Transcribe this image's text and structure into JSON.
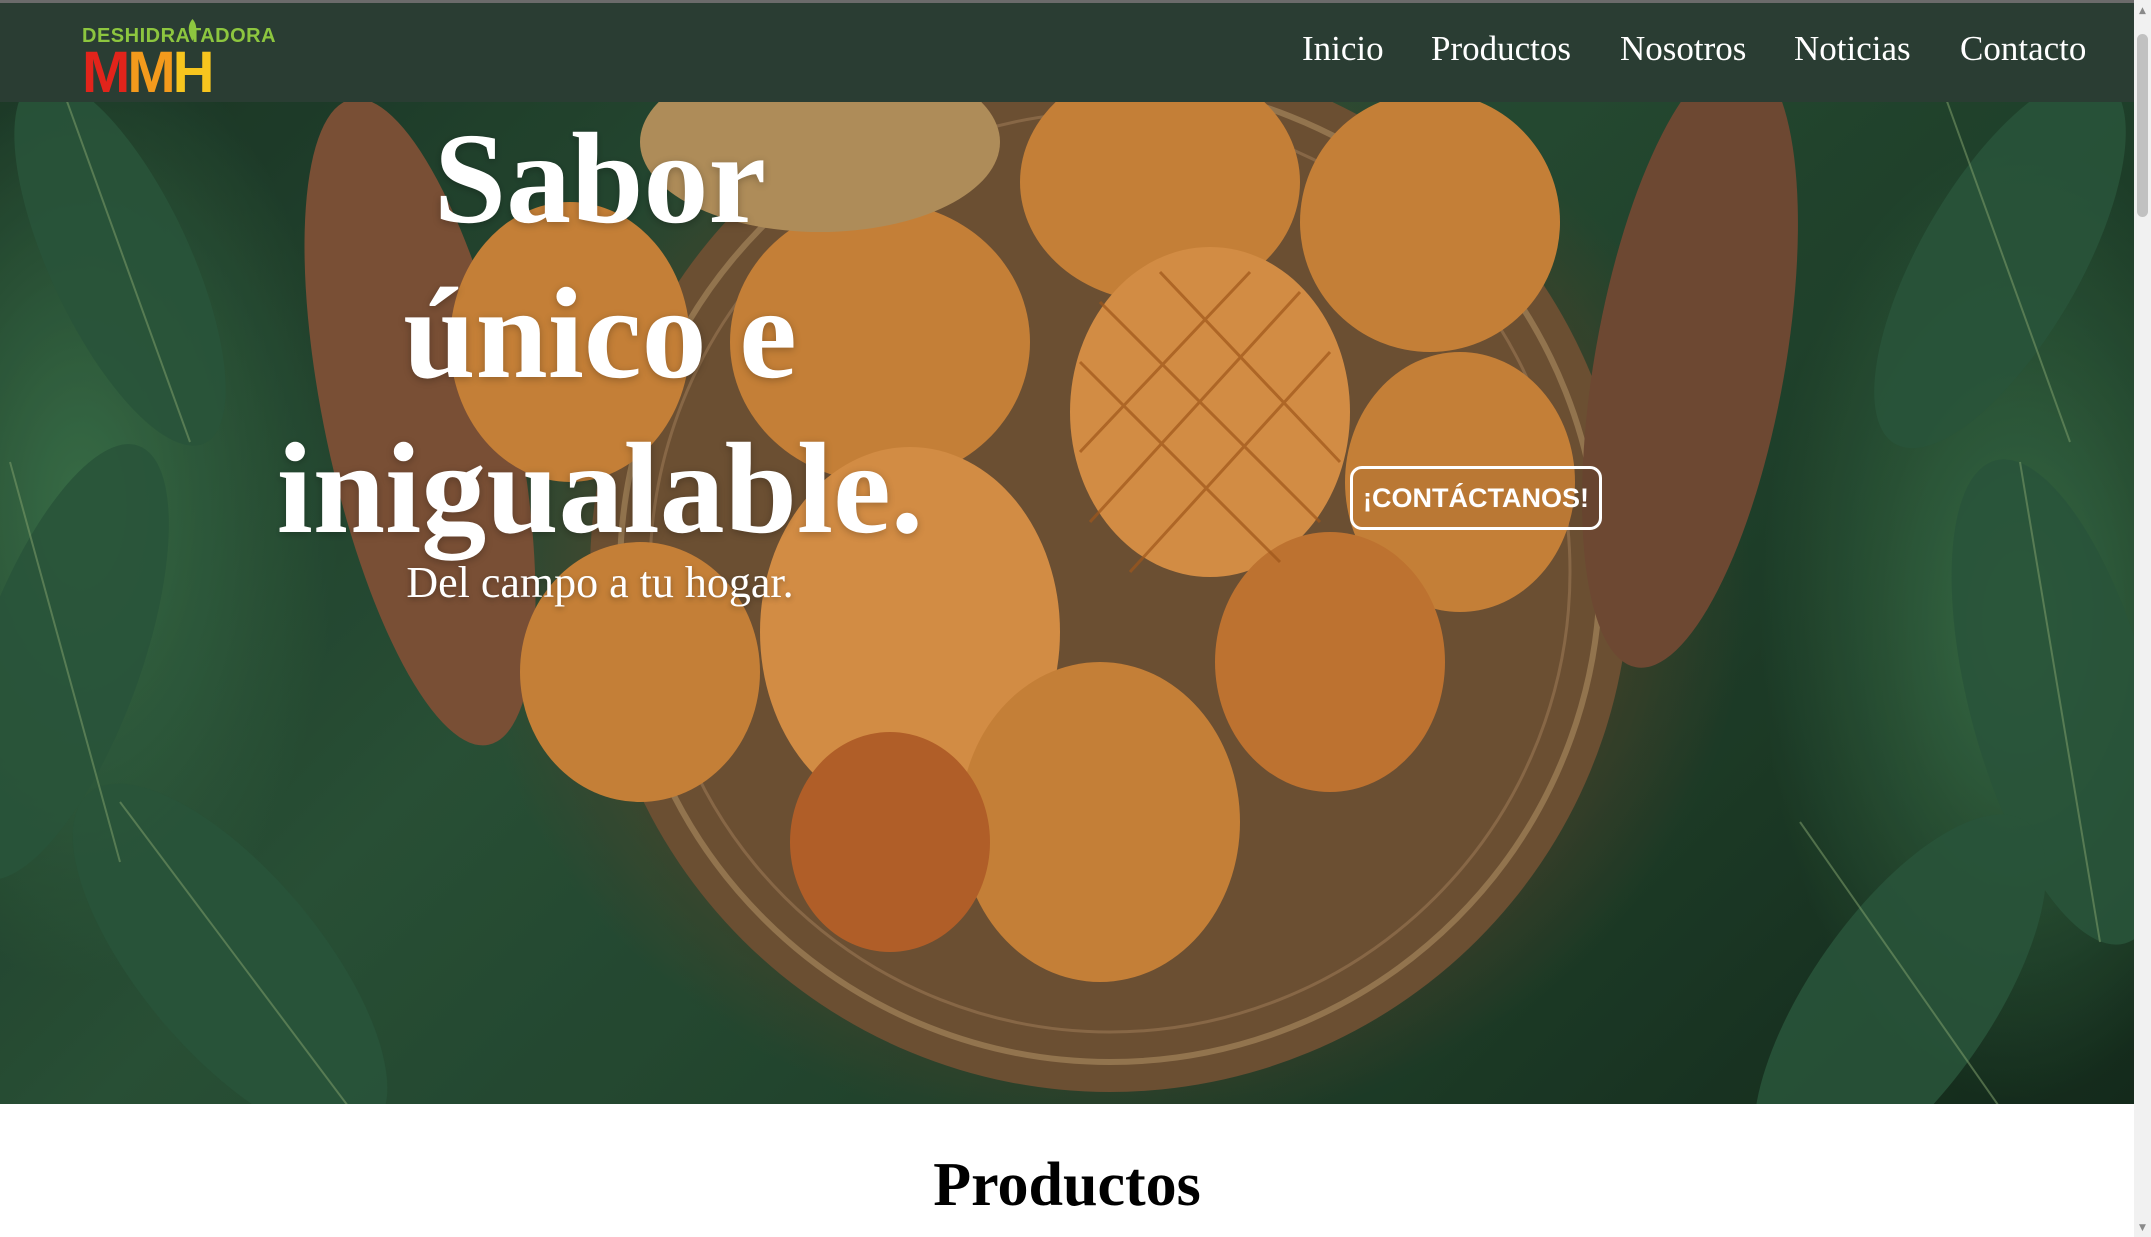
{
  "brand": {
    "logo_top": "DESHIDRATADORA",
    "logo_letters": [
      "M",
      "M",
      "H"
    ],
    "colors": {
      "green": "#8dc63f",
      "red": "#e2241b",
      "orange": "#f39a1c",
      "yellow": "#f7c51e"
    }
  },
  "nav": {
    "items": [
      "Inicio",
      "Productos",
      "Nosotros",
      "Noticias",
      "Contacto"
    ],
    "background": "#2a3d33"
  },
  "hero": {
    "title_lines": [
      "Sabor",
      "único e",
      "inigualable."
    ],
    "subtitle": "Del campo a tu hogar.",
    "cta_label": "¡CONTÁCTANOS!"
  },
  "products": {
    "heading": "Productos"
  }
}
